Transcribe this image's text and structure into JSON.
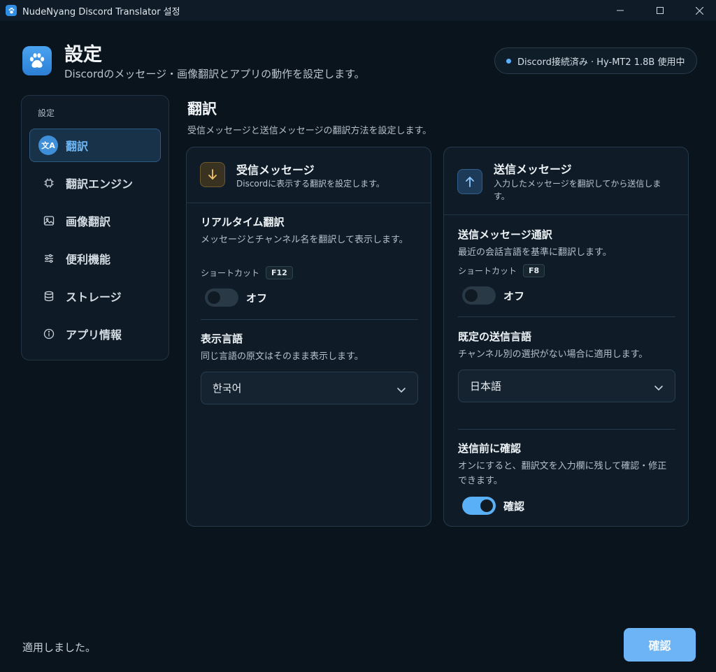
{
  "window": {
    "title": "NudeNyang Discord Translator 설정"
  },
  "header": {
    "title": "設定",
    "subtitle": "Discordのメッセージ・画像翻訳とアプリの動作を設定します。",
    "status": "Discord接続済み · Hy-MT2 1.8B 使用中"
  },
  "sidebar": {
    "section_label": "設定",
    "items": [
      {
        "label": "翻訳",
        "icon": "translate-icon",
        "active": true,
        "badge": "文A"
      },
      {
        "label": "翻訳エンジン",
        "icon": "chip-icon"
      },
      {
        "label": "画像翻訳",
        "icon": "image-icon"
      },
      {
        "label": "便利機能",
        "icon": "sliders-icon"
      },
      {
        "label": "ストレージ",
        "icon": "database-icon"
      },
      {
        "label": "アプリ情報",
        "icon": "info-icon"
      }
    ]
  },
  "main": {
    "title": "翻訳",
    "subtitle": "受信メッセージと送信メッセージの翻訳方法を設定します。"
  },
  "incoming": {
    "title": "受信メッセージ",
    "subtitle": "Discordに表示する翻訳を設定します。",
    "icon": "arrow-down-icon",
    "realtime": {
      "title": "リアルタイム翻訳",
      "desc": "メッセージとチャンネル名を翻訳して表示します。",
      "shortcut_label": "ショートカット",
      "shortcut_key": "F12",
      "toggle_label": "オフ",
      "enabled": false
    },
    "display_lang": {
      "title": "表示言語",
      "desc": "同じ言語の原文はそのまま表示します。",
      "value": "한국어"
    }
  },
  "outgoing": {
    "title": "送信メッセージ",
    "subtitle": "入力したメッセージを翻訳してから送信します。",
    "icon": "arrow-up-icon",
    "interpret": {
      "title": "送信メッセージ通訳",
      "desc": "最近の会話言語を基準に翻訳します。",
      "shortcut_label": "ショートカット",
      "shortcut_key": "F8",
      "toggle_label": "オフ",
      "enabled": false
    },
    "default_lang": {
      "title": "既定の送信言語",
      "desc": "チャンネル別の選択がない場合に適用します。",
      "value": "日本語"
    },
    "confirm_before": {
      "title": "送信前に確認",
      "desc": "オンにすると、翻訳文を入力欄に残して確認・修正できます。",
      "toggle_label": "確認",
      "enabled": true
    }
  },
  "footer": {
    "status": "適用しました。",
    "confirm_button": "確認"
  },
  "colors": {
    "accent": "#5ab0f6",
    "background": "#0a141d",
    "card": "#0f1c28"
  }
}
